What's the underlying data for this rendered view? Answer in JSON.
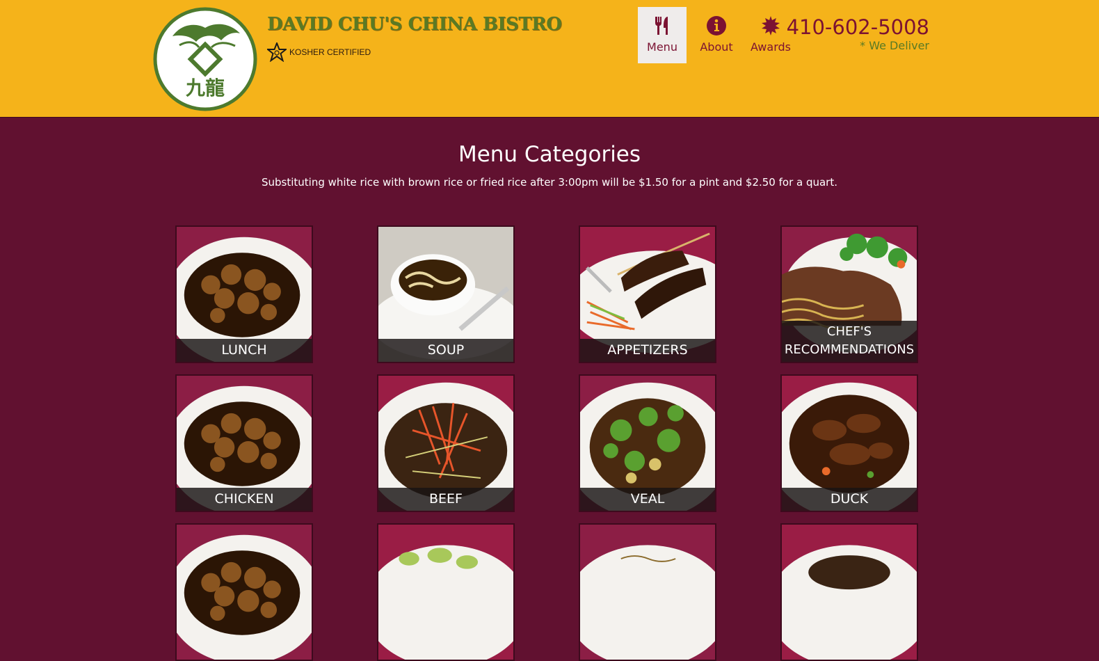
{
  "brand": {
    "title": "DAVID CHU'S CHINA BISTRO",
    "kosher": "KOSHER CERTIFIED",
    "logo_chars": "九龍"
  },
  "nav": [
    {
      "label": "Menu",
      "icon": "utensils-icon",
      "active": true
    },
    {
      "label": "About",
      "icon": "info-icon",
      "active": false
    },
    {
      "label": "Awards",
      "icon": "award-icon",
      "active": false
    }
  ],
  "contact": {
    "phone": "410-602-5008",
    "deliver": "* We Deliver"
  },
  "main": {
    "title": "Menu Categories",
    "note": "Substituting white rice with brown rice or fried rice after 3:00pm will be $1.50 for a pint and $2.50 for a quart."
  },
  "categories": [
    {
      "label": "LUNCH",
      "dish": "sauced-chunks"
    },
    {
      "label": "SOUP",
      "dish": "noodle-soup"
    },
    {
      "label": "APPETIZERS",
      "dish": "skewers"
    },
    {
      "label": "CHEF'S RECOMMENDATIONS",
      "dish": "meat-noodles"
    },
    {
      "label": "CHICKEN",
      "dish": "sauced-chunks"
    },
    {
      "label": "BEEF",
      "dish": "shredded-beef"
    },
    {
      "label": "VEAL",
      "dish": "broccoli-stirfry"
    },
    {
      "label": "DUCK",
      "dish": "braised-duck"
    },
    {
      "label": "",
      "dish": "sauced-chunks"
    },
    {
      "label": "",
      "dish": "greens"
    },
    {
      "label": "",
      "dish": "noodles"
    },
    {
      "label": "",
      "dish": "dark-meat"
    }
  ],
  "colors": {
    "header": "#f5b31a",
    "background": "#611130",
    "accent": "#7b1232",
    "green": "#5a7a24"
  }
}
